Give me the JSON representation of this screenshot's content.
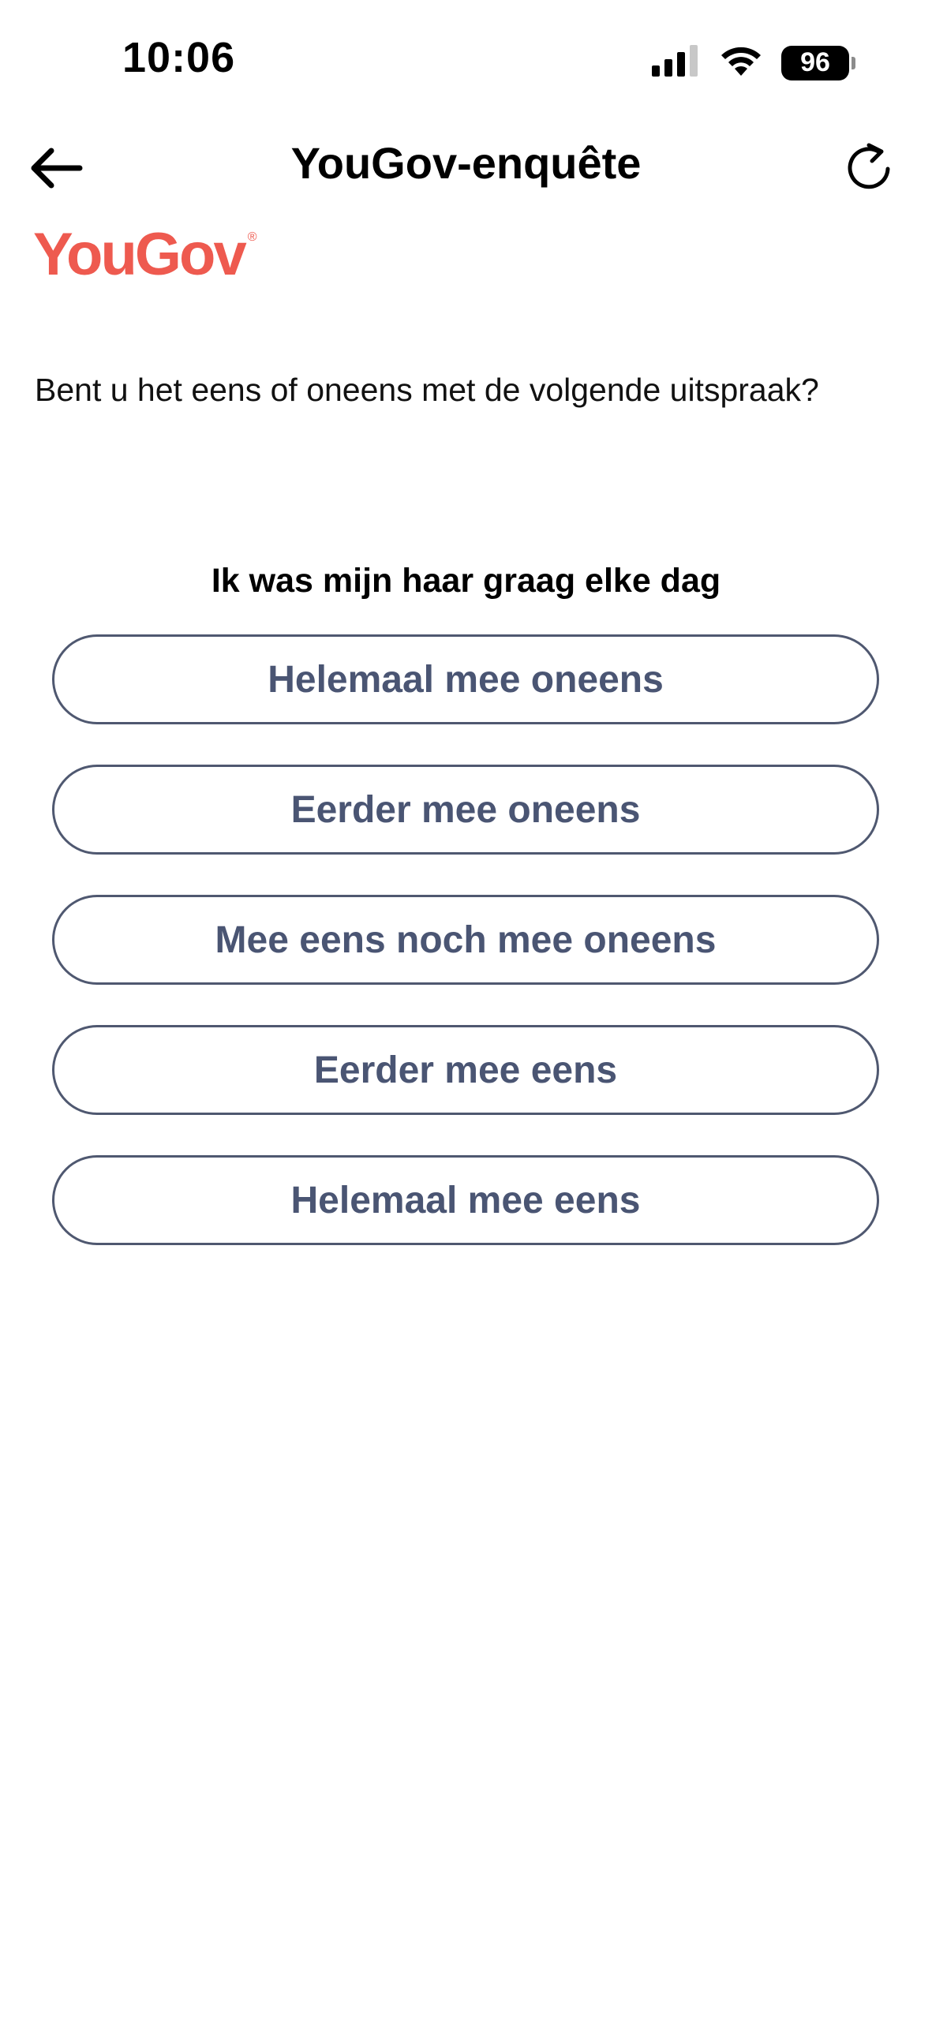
{
  "status_bar": {
    "time": "10:06",
    "battery": "96",
    "icons": [
      "cellular-signal-icon",
      "wifi-icon",
      "battery-icon"
    ]
  },
  "nav": {
    "title": "YouGov-enquête",
    "back_icon": "arrow-left-icon",
    "refresh_icon": "refresh-icon"
  },
  "logo": {
    "text": "YouGov",
    "mark": "®",
    "color": "#ee5a4f"
  },
  "question": "Bent u het eens of oneens met de volgende uitspraak?",
  "statement": "Ik was mijn haar graag elke dag",
  "options": [
    {
      "label": "Helemaal mee oneens"
    },
    {
      "label": "Eerder mee oneens"
    },
    {
      "label": "Mee eens noch mee oneens"
    },
    {
      "label": "Eerder mee eens"
    },
    {
      "label": "Helemaal mee eens"
    }
  ],
  "colors": {
    "option_border": "#4f5870",
    "option_text": "#4a5573"
  }
}
